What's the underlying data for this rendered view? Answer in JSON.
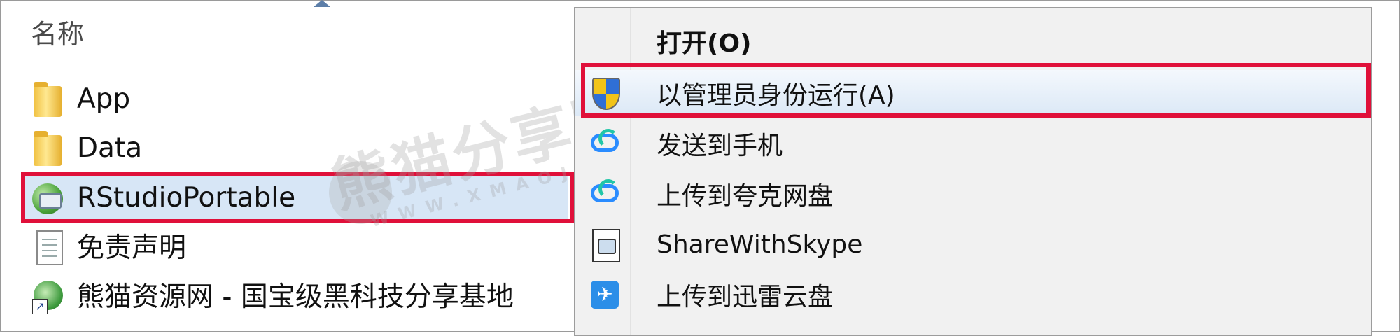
{
  "explorer": {
    "column_header": "名称",
    "files": [
      {
        "name": "App",
        "icon": "folder-icon"
      },
      {
        "name": "Data",
        "icon": "folder-icon"
      },
      {
        "name": "RStudioPortable",
        "icon": "application-icon",
        "selected": true
      },
      {
        "name": "免责声明",
        "icon": "text-document-icon"
      },
      {
        "name": "熊猫资源网 - 国宝级黑科技分享基地",
        "icon": "shortcut-icon"
      }
    ]
  },
  "context_menu": {
    "items": [
      {
        "label": "打开(O)",
        "icon": "",
        "bold": true
      },
      {
        "label": "以管理员身份运行(A)",
        "icon": "uac-shield-icon",
        "hover": true
      },
      {
        "label": "发送到手机",
        "icon": "cloud-icon"
      },
      {
        "label": "上传到夸克网盘",
        "icon": "cloud-icon"
      },
      {
        "label": "ShareWithSkype",
        "icon": "skype-share-icon"
      },
      {
        "label": "上传到迅雷云盘",
        "icon": "thunder-icon"
      }
    ]
  },
  "watermark": {
    "text": "熊猫分享网",
    "subtext": "WWW.XMAOJX.COM"
  },
  "colors": {
    "highlight_border": "#e0103a",
    "selection": "#d7e6f6",
    "menu_background": "#f1f1f1"
  }
}
